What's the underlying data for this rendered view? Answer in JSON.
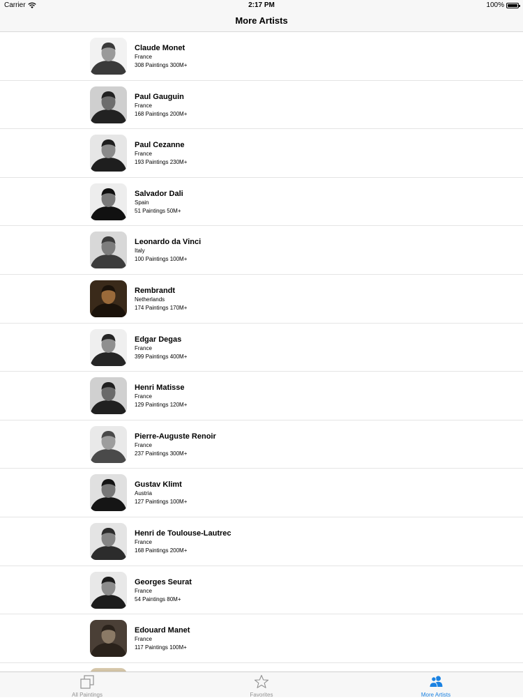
{
  "status_bar": {
    "carrier": "Carrier",
    "time": "2:17 PM",
    "battery": "100%"
  },
  "nav": {
    "title": "More Artists"
  },
  "artists": [
    {
      "name": "Claude Monet",
      "country": "France",
      "stats": "308 Paintings 300M+",
      "portrait_tone": [
        "#f2f2f2",
        "#9a9a9a",
        "#3a3a3a"
      ]
    },
    {
      "name": "Paul Gauguin",
      "country": "France",
      "stats": "168 Paintings 200M+",
      "portrait_tone": [
        "#cfcfcf",
        "#6d6d6d",
        "#222222"
      ]
    },
    {
      "name": "Paul Cezanne",
      "country": "France",
      "stats": "193 Paintings 230M+",
      "portrait_tone": [
        "#e6e6e6",
        "#8a8a8a",
        "#1e1e1e"
      ]
    },
    {
      "name": "Salvador Dali",
      "country": "Spain",
      "stats": "51 Paintings 50M+",
      "portrait_tone": [
        "#ededed",
        "#7a7a7a",
        "#111111"
      ]
    },
    {
      "name": "Leonardo da Vinci",
      "country": "Italy",
      "stats": "100 Paintings 100M+",
      "portrait_tone": [
        "#d8d8d8",
        "#7d7d7d",
        "#3c3c3c"
      ]
    },
    {
      "name": "Rembrandt",
      "country": "Netherlands",
      "stats": "174 Paintings 170M+",
      "portrait_tone": [
        "#3a2a1a",
        "#9a6a3a",
        "#1a120a"
      ]
    },
    {
      "name": "Edgar Degas",
      "country": "France",
      "stats": "399 Paintings 400M+",
      "portrait_tone": [
        "#efefef",
        "#8f8f8f",
        "#262626"
      ]
    },
    {
      "name": "Henri Matisse",
      "country": "France",
      "stats": "129 Paintings 120M+",
      "portrait_tone": [
        "#d0d0d0",
        "#6a6a6a",
        "#202020"
      ]
    },
    {
      "name": "Pierre-Auguste Renoir",
      "country": "France",
      "stats": "237 Paintings 300M+",
      "portrait_tone": [
        "#e9e9e9",
        "#9d9d9d",
        "#4a4a4a"
      ]
    },
    {
      "name": "Gustav Klimt",
      "country": "Austria",
      "stats": "127 Paintings 100M+",
      "portrait_tone": [
        "#e0e0e0",
        "#777777",
        "#151515"
      ]
    },
    {
      "name": "Henri de Toulouse-Lautrec",
      "country": "France",
      "stats": "168 Paintings 200M+",
      "portrait_tone": [
        "#e4e4e4",
        "#858585",
        "#2c2c2c"
      ]
    },
    {
      "name": "Georges Seurat",
      "country": "France",
      "stats": "54 Paintings 80M+",
      "portrait_tone": [
        "#e8e8e8",
        "#8c8c8c",
        "#1c1c1c"
      ]
    },
    {
      "name": "Edouard Manet",
      "country": "France",
      "stats": "117 Paintings 100M+",
      "portrait_tone": [
        "#4a3f36",
        "#8b7a66",
        "#2a221b"
      ]
    }
  ],
  "tabs": [
    {
      "label": "All Paintings",
      "icon": "all-paintings-icon",
      "active": false
    },
    {
      "label": "Favorites",
      "icon": "star-icon",
      "active": false
    },
    {
      "label": "More Artists",
      "icon": "people-icon",
      "active": true
    }
  ],
  "colors": {
    "accent": "#1a82e2",
    "tab_inactive": "#929292"
  }
}
